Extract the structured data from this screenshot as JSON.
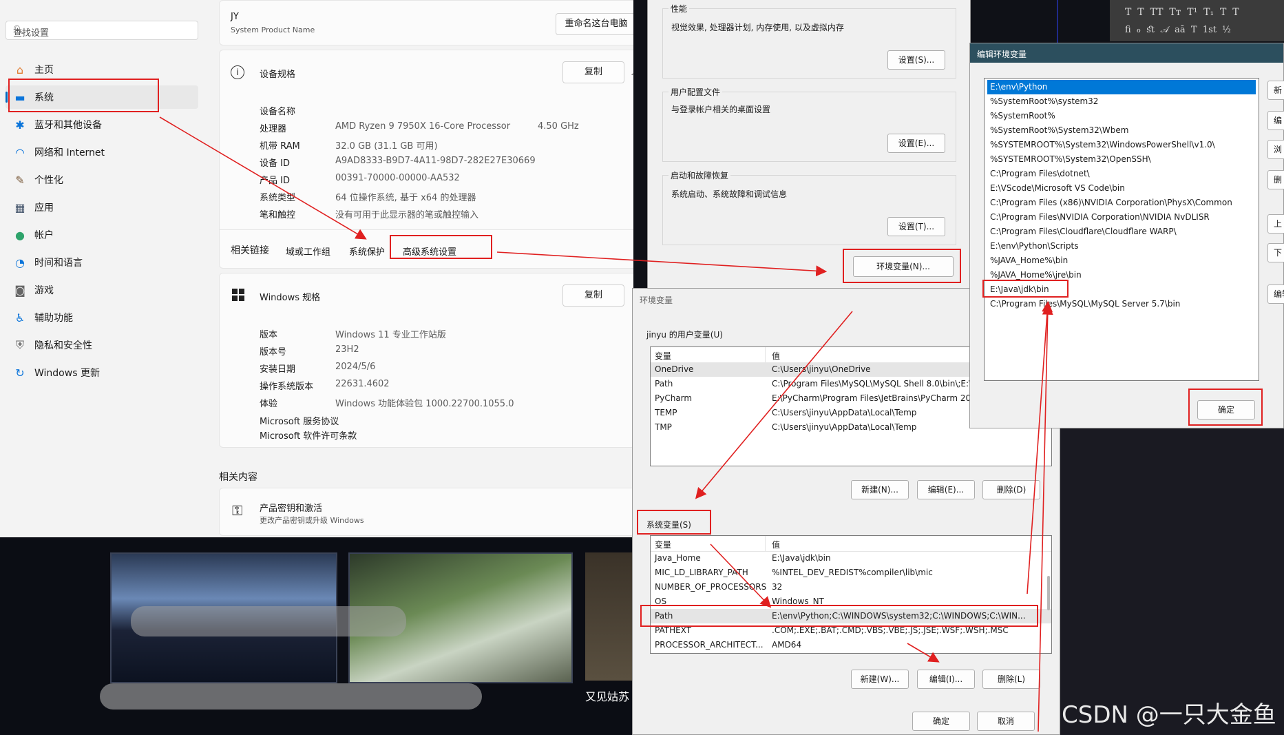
{
  "settings": {
    "search_placeholder": "查找设置",
    "nav": [
      {
        "label": "主页",
        "icon": "home-icon",
        "glyph": "⌂",
        "color": "#e07a2e"
      },
      {
        "label": "系统",
        "icon": "system-display-icon",
        "glyph": "▬",
        "color": "#0a74da"
      },
      {
        "label": "蓝牙和其他设备",
        "icon": "bluetooth-icon",
        "glyph": "✱",
        "color": "#0a74da"
      },
      {
        "label": "网络和 Internet",
        "icon": "wifi-icon",
        "glyph": "◠",
        "color": "#0a74da"
      },
      {
        "label": "个性化",
        "icon": "brush-icon",
        "glyph": "✎",
        "color": "#7a5a3a"
      },
      {
        "label": "应用",
        "icon": "apps-icon",
        "glyph": "▦",
        "color": "#4a5a70"
      },
      {
        "label": "帐户",
        "icon": "account-icon",
        "glyph": "●",
        "color": "#2ea36b"
      },
      {
        "label": "时间和语言",
        "icon": "globe-clock-icon",
        "glyph": "◔",
        "color": "#0a74da"
      },
      {
        "label": "游戏",
        "icon": "gamepad-icon",
        "glyph": "◙",
        "color": "#666"
      },
      {
        "label": "辅助功能",
        "icon": "accessibility-icon",
        "glyph": "♿",
        "color": "#0a74da"
      },
      {
        "label": "隐私和安全性",
        "icon": "shield-icon",
        "glyph": "⛨",
        "color": "#666"
      },
      {
        "label": "Windows 更新",
        "icon": "update-icon",
        "glyph": "↻",
        "color": "#0a74da"
      }
    ],
    "pc_name": "JY",
    "pc_model": "System Product Name",
    "rename_button": "重命名这台电脑",
    "device_spec_title": "设备规格",
    "copy_button": "复制",
    "device_specs": [
      {
        "label": "设备名称",
        "value": ""
      },
      {
        "label": "处理器",
        "value": "AMD Ryzen 9 7950X 16-Core Processor",
        "extra": "4.50 GHz"
      },
      {
        "label": "机带 RAM",
        "value": "32.0 GB (31.1 GB 可用)"
      },
      {
        "label": "设备 ID",
        "value": "A9AD8333-B9D7-4A11-98D7-282E27E30669"
      },
      {
        "label": "产品 ID",
        "value": "00391-70000-00000-AA532"
      },
      {
        "label": "系统类型",
        "value": "64 位操作系统, 基于 x64 的处理器"
      },
      {
        "label": "笔和触控",
        "value": "没有可用于此显示器的笔或触控输入"
      }
    ],
    "related_links_label": "相关链接",
    "related_links": [
      "域或工作组",
      "系统保护",
      "高级系统设置"
    ],
    "windows_spec_title": "Windows 规格",
    "windows_specs": [
      {
        "label": "版本",
        "value": "Windows 11 专业工作站版"
      },
      {
        "label": "版本号",
        "value": "23H2"
      },
      {
        "label": "安装日期",
        "value": "2024/5/6"
      },
      {
        "label": "操作系统版本",
        "value": "22631.4602"
      },
      {
        "label": "体验",
        "value": "Windows 功能体验包 1000.22700.1055.0"
      }
    ],
    "ms_service_agreement": "Microsoft 服务协议",
    "ms_license_terms": "Microsoft 软件许可条款",
    "related_content_title": "相关内容",
    "product_key_title": "产品密钥和激活",
    "product_key_desc": "更改产品密钥或升级 Windows"
  },
  "sysprops": {
    "perf_title": "性能",
    "perf_desc": "视觉效果, 处理器计划, 内存使用, 以及虚拟内存",
    "perf_button": "设置(S)...",
    "profile_title": "用户配置文件",
    "profile_desc": "与登录帐户相关的桌面设置",
    "profile_button": "设置(E)...",
    "startup_title": "启动和故障恢复",
    "startup_desc": "系统启动、系统故障和调试信息",
    "startup_button": "设置(T)...",
    "env_button": "环境变量(N)..."
  },
  "envvars": {
    "title": "环境变量",
    "user_group": "jinyu 的用户变量(U)",
    "col_var": "变量",
    "col_val": "值",
    "user_rows": [
      {
        "name": "OneDrive",
        "value": "C:\\Users\\jinyu\\OneDrive"
      },
      {
        "name": "Path",
        "value": "C:\\Program Files\\MySQL\\MySQL Shell 8.0\\bin\\;E:\\"
      },
      {
        "name": "PyCharm",
        "value": "E:\\PyCharm\\Program Files\\JetBrains\\PyCharm 202"
      },
      {
        "name": "TEMP",
        "value": "C:\\Users\\jinyu\\AppData\\Local\\Temp"
      },
      {
        "name": "TMP",
        "value": "C:\\Users\\jinyu\\AppData\\Local\\Temp"
      }
    ],
    "user_new": "新建(N)...",
    "user_edit": "编辑(E)...",
    "user_delete": "删除(D)",
    "system_group": "系统变量(S)",
    "system_rows": [
      {
        "name": "Java_Home",
        "value": "E:\\Java\\jdk\\bin"
      },
      {
        "name": "MIC_LD_LIBRARY_PATH",
        "value": "%INTEL_DEV_REDIST%compiler\\lib\\mic"
      },
      {
        "name": "NUMBER_OF_PROCESSORS",
        "value": "32"
      },
      {
        "name": "OS",
        "value": "Windows_NT"
      },
      {
        "name": "Path",
        "value": "E:\\env\\Python;C:\\WINDOWS\\system32;C:\\WINDOWS;C:\\WIN..."
      },
      {
        "name": "PATHEXT",
        "value": ".COM;.EXE;.BAT;.CMD;.VBS;.VBE;.JS;.JSE;.WSF;.WSH;.MSC"
      },
      {
        "name": "PROCESSOR_ARCHITECT...",
        "value": "AMD64"
      }
    ],
    "sys_new": "新建(W)...",
    "sys_edit": "编辑(I)...",
    "sys_delete": "删除(L)",
    "ok": "确定",
    "cancel": "取消"
  },
  "editenv": {
    "title": "编辑环境变量",
    "entries": [
      "E:\\env\\Python",
      "%SystemRoot%\\system32",
      "%SystemRoot%",
      "%SystemRoot%\\System32\\Wbem",
      "%SYSTEMROOT%\\System32\\WindowsPowerShell\\v1.0\\",
      "%SYSTEMROOT%\\System32\\OpenSSH\\",
      "C:\\Program Files\\dotnet\\",
      "E:\\VScode\\Microsoft VS Code\\bin",
      "C:\\Program Files (x86)\\NVIDIA Corporation\\PhysX\\Common",
      "C:\\Program Files\\NVIDIA Corporation\\NVIDIA NvDLISR",
      "C:\\Program Files\\Cloudflare\\Cloudflare WARP\\",
      "E:\\env\\Python\\Scripts",
      "%JAVA_Home%\\bin",
      "%JAVA_Home%\\jre\\bin",
      "E:\\Java\\jdk\\bin",
      "C:\\Program Files\\MySQL\\MySQL Server 5.7\\bin"
    ],
    "side_buttons": [
      "新",
      "编",
      "浏",
      "删",
      "上",
      "下",
      "编辑"
    ],
    "ok": "确定"
  },
  "background": {
    "caption": "又见姑苏"
  },
  "watermark": "CSDN @一只大金鱼",
  "colors": {
    "accent": "#0067c0",
    "highlight_red": "#e02020",
    "selection": "#0078d7"
  }
}
